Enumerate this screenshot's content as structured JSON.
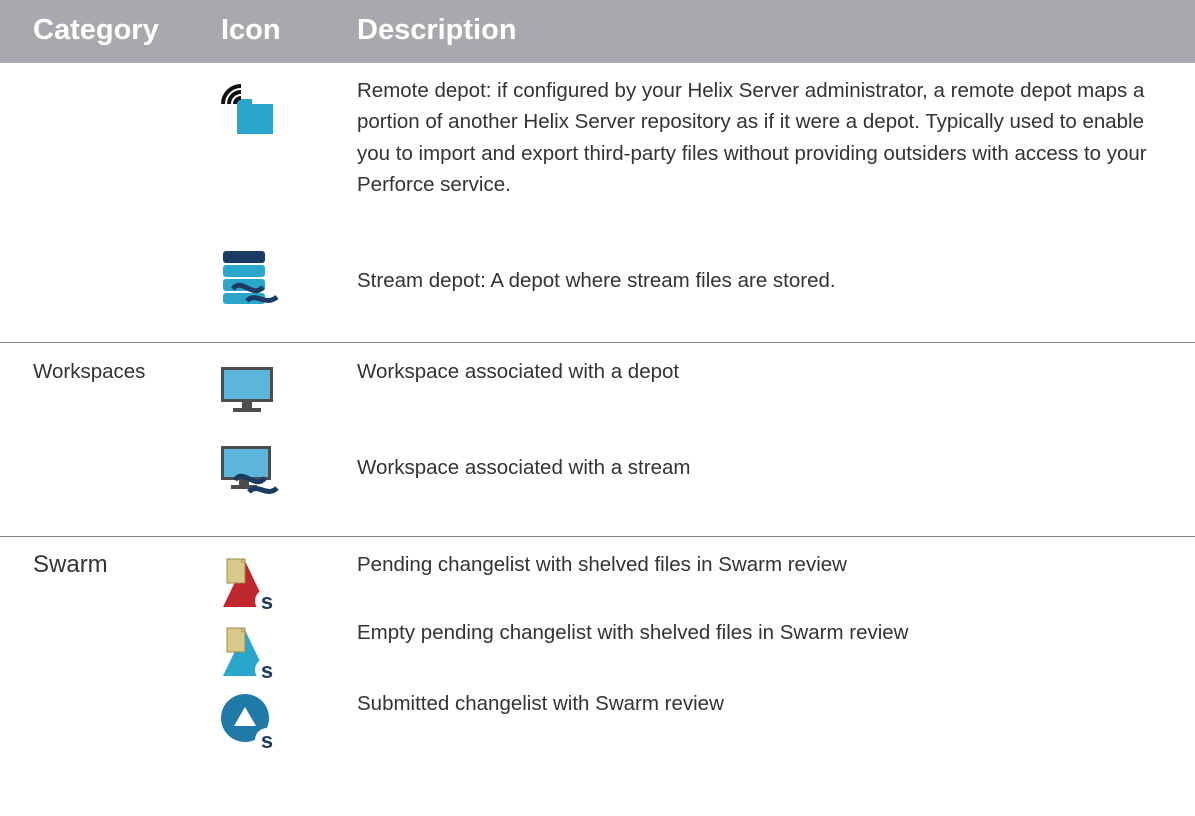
{
  "table": {
    "headers": {
      "category": "Category",
      "icon": "Icon",
      "description": "Description"
    },
    "colors": {
      "header_background": "#a7a9ac",
      "header_text": "#ffffff",
      "body_text": "#333333",
      "rule": "#888888",
      "icon_blue": "#29a6c9",
      "icon_navy": "#1b3b63",
      "icon_red": "#c0262d",
      "icon_paper": "#d8c88a"
    },
    "rows": [
      {
        "category": "",
        "icon": "remote-depot-icon",
        "description": "Remote depot: if configured by your Helix Server administrator, a remote depot maps a portion of another Helix Server repository as if it were a depot. Typically used to enable you to import and export third-party files without providing outsiders with access to your Perforce service."
      },
      {
        "category": "",
        "icon": "stream-depot-icon",
        "description": "Stream depot: A depot where stream files are stored."
      },
      {
        "category": "Workspaces",
        "icon": "workspace-icon",
        "description": "Workspace associated with a depot"
      },
      {
        "category": "",
        "icon": "stream-workspace-icon",
        "description": "Workspace associated with a stream"
      },
      {
        "category": "Swarm",
        "icon": "pending-changelist-swarm-icon",
        "description": "Pending changelist with shelved files in Swarm review"
      },
      {
        "category": "",
        "icon": "empty-pending-changelist-swarm-icon",
        "description": "Empty pending changelist with shelved files in Swarm review"
      },
      {
        "category": "",
        "icon": "submitted-changelist-swarm-icon",
        "description": "Submitted changelist with Swarm review"
      }
    ]
  }
}
